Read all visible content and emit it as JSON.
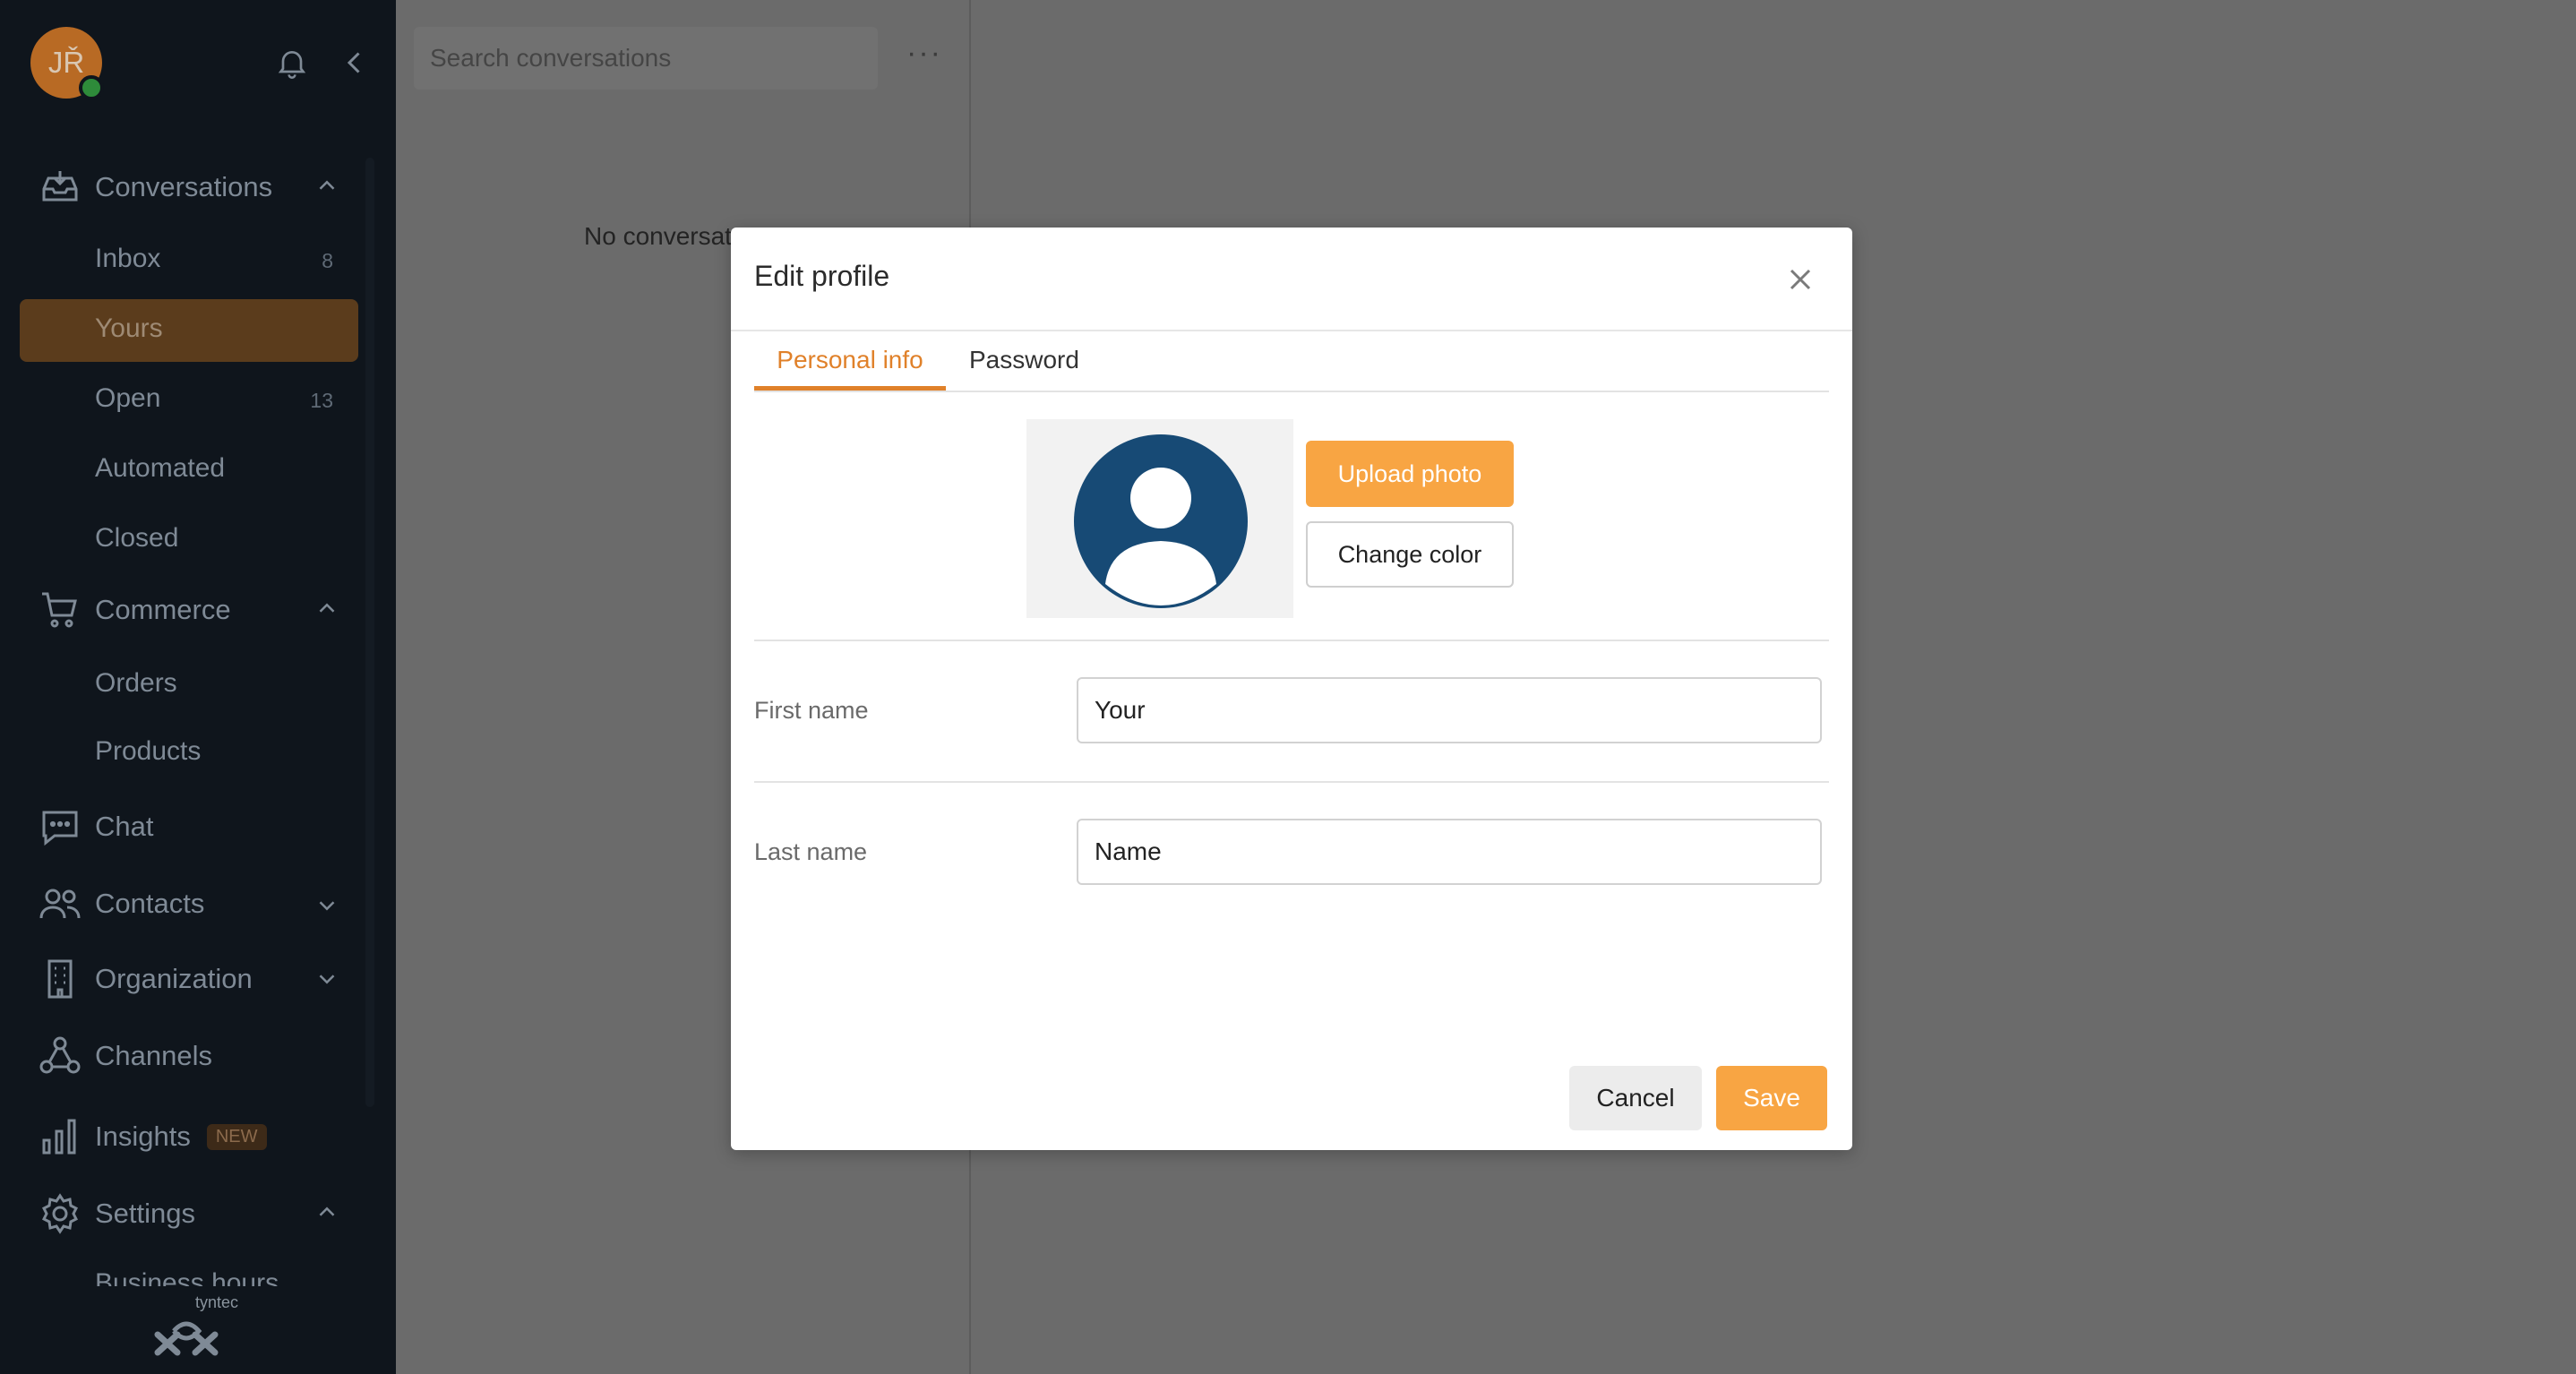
{
  "user": {
    "initials": "JŘ"
  },
  "sidebar": {
    "sections": {
      "conversations": {
        "label": "Conversations",
        "icon": "inbox-tray-icon"
      },
      "commerce": {
        "label": "Commerce",
        "icon": "cart-icon"
      },
      "chat": {
        "label": "Chat",
        "icon": "chat-bubble-icon"
      },
      "contacts": {
        "label": "Contacts",
        "icon": "people-icon"
      },
      "organization": {
        "label": "Organization",
        "icon": "building-icon"
      },
      "channels": {
        "label": "Channels",
        "icon": "nodes-icon"
      },
      "insights": {
        "label": "Insights",
        "icon": "bar-chart-icon",
        "badge": "NEW"
      },
      "settings": {
        "label": "Settings",
        "icon": "gear-icon"
      }
    },
    "items": {
      "inbox": {
        "label": "Inbox",
        "count": "8"
      },
      "yours": {
        "label": "Yours"
      },
      "open": {
        "label": "Open",
        "count": "13"
      },
      "automated": {
        "label": "Automated"
      },
      "closed": {
        "label": "Closed"
      },
      "orders": {
        "label": "Orders"
      },
      "products": {
        "label": "Products"
      },
      "business_hours": {
        "label": "Business hours"
      }
    },
    "logo_text": "tyntec"
  },
  "list": {
    "search_placeholder": "Search conversations",
    "more": "···",
    "empty_text": "No conversat"
  },
  "modal": {
    "title": "Edit profile",
    "tabs": [
      "Personal info",
      "Password"
    ],
    "upload_label": "Upload photo",
    "change_color_label": "Change color",
    "first_name_label": "First name",
    "first_name_value": "Your",
    "last_name_label": "Last name",
    "last_name_value": "Name",
    "cancel_label": "Cancel",
    "save_label": "Save"
  },
  "colors": {
    "accent": "#f8a543",
    "tab_accent": "#e0812a",
    "avatar_placeholder": "#174a75",
    "sidebar_bg": "#0f151c"
  }
}
